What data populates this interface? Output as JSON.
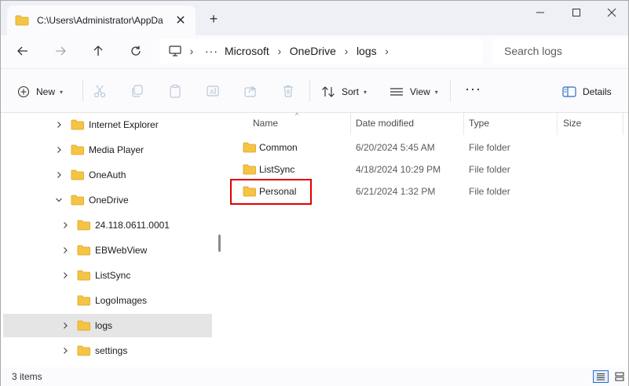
{
  "window": {
    "tab_title": "C:\\Users\\Administrator\\AppDa",
    "tab_close": "✕",
    "new_tab": "+"
  },
  "address": {
    "ellipsis": "···",
    "crumbs": [
      "Microsoft",
      "OneDrive",
      "logs"
    ],
    "search_placeholder": "Search logs"
  },
  "toolbar": {
    "new_label": "New",
    "sort_label": "Sort",
    "view_label": "View",
    "more_label": "···",
    "details_label": "Details"
  },
  "tree": {
    "items": [
      {
        "label": "Internet Explorer",
        "expanded": false
      },
      {
        "label": "Media Player",
        "expanded": false
      },
      {
        "label": "OneAuth",
        "expanded": false
      },
      {
        "label": "OneDrive",
        "expanded": true
      },
      {
        "label": "24.118.0611.0001",
        "expanded": false
      },
      {
        "label": "EBWebView",
        "expanded": false
      },
      {
        "label": "ListSync",
        "expanded": false
      },
      {
        "label": "LogoImages",
        "expanded": null
      },
      {
        "label": "logs",
        "expanded": false,
        "selected": true
      },
      {
        "label": "settings",
        "expanded": false
      }
    ]
  },
  "columns": {
    "name": "Name",
    "date": "Date modified",
    "type": "Type",
    "size": "Size"
  },
  "files": [
    {
      "name": "Common",
      "date": "6/20/2024 5:45 AM",
      "type": "File folder"
    },
    {
      "name": "ListSync",
      "date": "4/18/2024 10:29 PM",
      "type": "File folder"
    },
    {
      "name": "Personal",
      "date": "6/21/2024 1:32 PM",
      "type": "File folder"
    }
  ],
  "status": {
    "item_count": "3 items"
  },
  "colors": {
    "folder": "#f6c444",
    "highlight": "#e00000",
    "accent": "#2a6fc7"
  }
}
